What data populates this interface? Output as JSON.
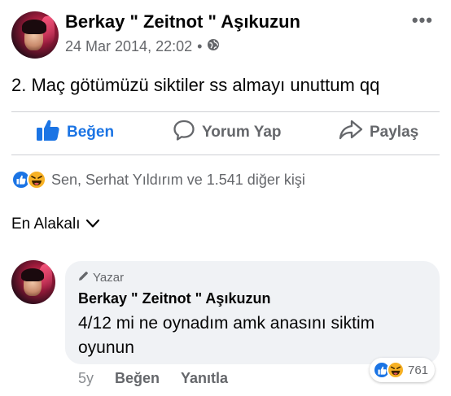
{
  "post": {
    "author": "Berkay \" Zeitnot \" Aşıkuzun",
    "timestamp": "24 Mar 2014, 22:02",
    "privacy_icon": "globe-icon",
    "text": "2. Maç götümüzü siktiler ss almayı unuttum qq"
  },
  "actions": {
    "like": "Beğen",
    "comment": "Yorum Yap",
    "share": "Paylaş"
  },
  "reactions": {
    "icons": [
      "like-icon",
      "haha-icon"
    ],
    "summary": "Sen, Serhat Yıldırım ve 1.541 diğer kişi"
  },
  "sort": {
    "label": "En Alakalı"
  },
  "comment": {
    "tag": "Yazar",
    "author": "Berkay \" Zeitnot \" Aşıkuzun",
    "text": "4/12 mi ne oynadım amk anasını siktim oyunun",
    "reaction_count": "761",
    "time": "5y",
    "like_label": "Beğen",
    "reply_label": "Yanıtla"
  },
  "colors": {
    "accent": "#1b74e4",
    "muted": "#65676b",
    "bubble": "#f0f2f5",
    "haha": "#f7b125"
  }
}
